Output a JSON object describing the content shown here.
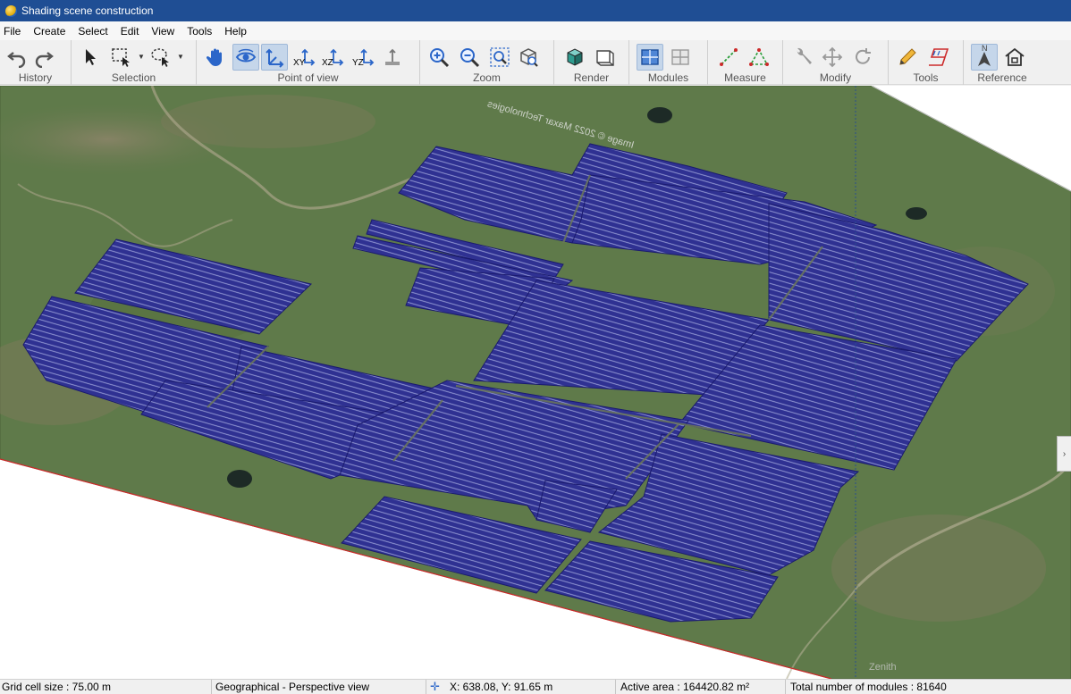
{
  "window": {
    "title": "Shading scene construction"
  },
  "menu": [
    "File",
    "Create",
    "Select",
    "Edit",
    "View",
    "Tools",
    "Help"
  ],
  "toolbar": {
    "groups": {
      "history": "History",
      "selection": "Selection",
      "point_of_view": "Point of view",
      "zoom": "Zoom",
      "render": "Render",
      "modules": "Modules",
      "measure": "Measure",
      "modify": "Modify",
      "tools": "Tools",
      "reference": "Reference"
    },
    "axis_labels": {
      "xy": "XY",
      "xz": "XZ",
      "yz": "YZ",
      "north": "N"
    }
  },
  "viewport": {
    "imagery_credit": "Image © 2022 Maxar Technologies",
    "zenith_label": "Zenith",
    "colors": {
      "ground": "#5f7a4a",
      "modules": "#2e2f8c",
      "module_lines": "#1a1a6e",
      "axis_red": "#cc2a2a"
    }
  },
  "status": {
    "grid_cell": "Grid cell size : 75.00 m",
    "view_mode": "Geographical - Perspective view",
    "coords": "X: 638.08, Y: 91.65 m",
    "active_area": "Active area : 164420.82 m²",
    "modules_total": "Total number of modules : 81640"
  }
}
